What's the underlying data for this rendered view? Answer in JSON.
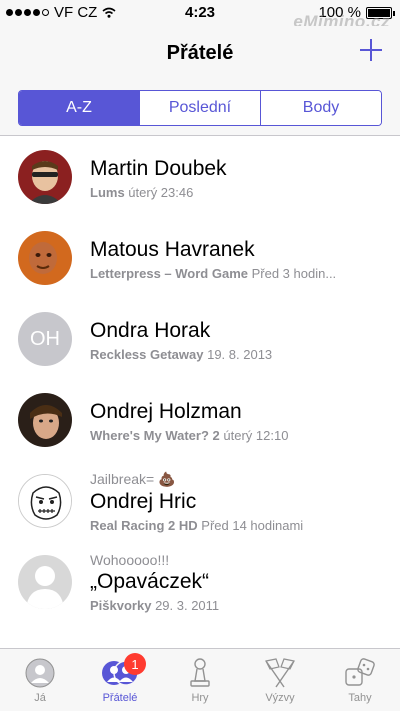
{
  "status_bar": {
    "carrier": "VF CZ",
    "time": "4:23",
    "battery": "100 %",
    "battery_level": 1.0,
    "watermark": "eMimino.cz"
  },
  "nav": {
    "title": "Přátelé",
    "add_icon": "plus-icon"
  },
  "segments": [
    {
      "label": "A-Z",
      "selected": true
    },
    {
      "label": "Poslední",
      "selected": false
    },
    {
      "label": "Body",
      "selected": false
    }
  ],
  "friends": [
    {
      "name": "Martin Doubek",
      "game": "Lums",
      "time": "úterý 23:46",
      "status": "",
      "avatar": "photo",
      "avatar_color": "#8b2020"
    },
    {
      "name": "Matous Havranek",
      "game": "Letterpress – Word Game",
      "time": "Před 3 hodin...",
      "status": "",
      "avatar": "photo",
      "avatar_color": "#d2691e"
    },
    {
      "name": "Ondra Horak",
      "game": "Reckless Getaway",
      "time": "19. 8. 2013",
      "status": "",
      "avatar": "initials",
      "initials": "OH",
      "avatar_color": "#c7c7cc"
    },
    {
      "name": "Ondrej Holzman",
      "game": "Where's My Water? 2",
      "time": "úterý 12:10",
      "status": "",
      "avatar": "photo",
      "avatar_color": "#3a2a1a"
    },
    {
      "name": "Ondrej Hric",
      "game": "Real Racing 2 HD",
      "time": "Před 14 hodinami",
      "status": "Jailbreak=",
      "status_emoji": "💩",
      "avatar": "meme",
      "avatar_color": "#ffffff"
    },
    {
      "name": "„Opaváczek“",
      "game": "Piškvorky",
      "time": "29. 3. 2011",
      "status": "Wohooooo!!!",
      "avatar": "silhouette",
      "avatar_color": "#d8d8d8"
    }
  ],
  "tabs": [
    {
      "label": "Já",
      "icon": "person-icon",
      "active": false
    },
    {
      "label": "Přátelé",
      "icon": "friends-icon",
      "active": true,
      "badge": "1"
    },
    {
      "label": "Hry",
      "icon": "pawn-icon",
      "active": false
    },
    {
      "label": "Výzvy",
      "icon": "flags-icon",
      "active": false
    },
    {
      "label": "Tahy",
      "icon": "dice-icon",
      "active": false
    }
  ],
  "colors": {
    "accent": "#5856d6",
    "badge": "#ff3b30",
    "secondary_text": "#8e8e93",
    "bar_background": "#f7f7f7"
  }
}
